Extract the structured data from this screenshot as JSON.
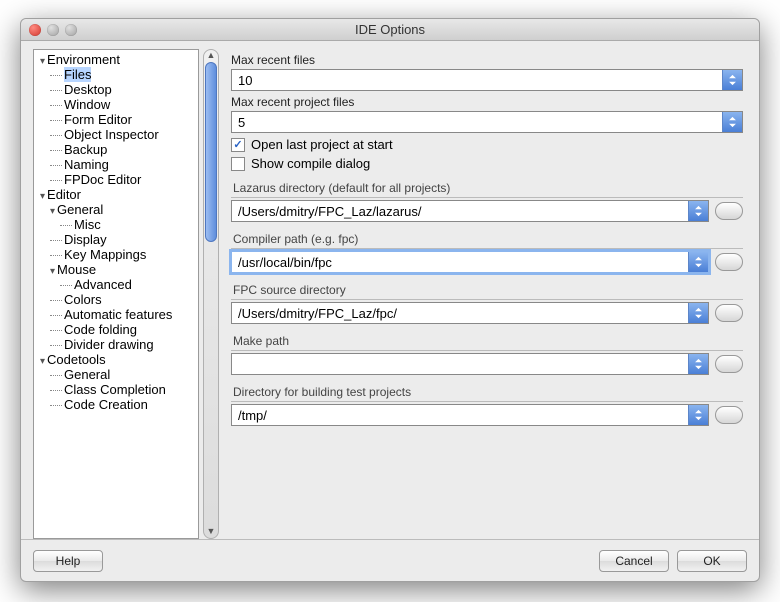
{
  "window": {
    "title": "IDE Options"
  },
  "tree": {
    "nodes": [
      {
        "label": "Environment",
        "level": 0,
        "disc": true
      },
      {
        "label": "Files",
        "level": 1,
        "selected": true
      },
      {
        "label": "Desktop",
        "level": 1
      },
      {
        "label": "Window",
        "level": 1
      },
      {
        "label": "Form Editor",
        "level": 1
      },
      {
        "label": "Object Inspector",
        "level": 1
      },
      {
        "label": "Backup",
        "level": 1
      },
      {
        "label": "Naming",
        "level": 1
      },
      {
        "label": "FPDoc Editor",
        "level": 1
      },
      {
        "label": "Editor",
        "level": 0,
        "disc": true
      },
      {
        "label": "General",
        "level": 1,
        "disc": true
      },
      {
        "label": "Misc",
        "level": 2
      },
      {
        "label": "Display",
        "level": 1
      },
      {
        "label": "Key Mappings",
        "level": 1
      },
      {
        "label": "Mouse",
        "level": 1,
        "disc": true
      },
      {
        "label": "Advanced",
        "level": 2
      },
      {
        "label": "Colors",
        "level": 1
      },
      {
        "label": "Automatic features",
        "level": 1
      },
      {
        "label": "Code folding",
        "level": 1
      },
      {
        "label": "Divider drawing",
        "level": 1
      },
      {
        "label": "Codetools",
        "level": 0,
        "disc": true
      },
      {
        "label": "General",
        "level": 1
      },
      {
        "label": "Class Completion",
        "level": 1
      },
      {
        "label": "Code Creation",
        "level": 1
      }
    ]
  },
  "form": {
    "maxRecentFiles": {
      "label": "Max recent files",
      "value": "10"
    },
    "maxRecentProjects": {
      "label": "Max recent project files",
      "value": "5"
    },
    "openLast": {
      "label": "Open last project at start",
      "checked": true
    },
    "showCompile": {
      "label": "Show compile dialog",
      "checked": false
    },
    "lazDir": {
      "label": "Lazarus directory (default for all projects)",
      "value": "/Users/dmitry/FPC_Laz/lazarus/"
    },
    "compilerPath": {
      "label": "Compiler path (e.g. fpc)",
      "value": "/usr/local/bin/fpc"
    },
    "fpcSrc": {
      "label": "FPC source directory",
      "value": "/Users/dmitry/FPC_Laz/fpc/"
    },
    "makePath": {
      "label": "Make path",
      "value": ""
    },
    "testDir": {
      "label": "Directory for building test projects",
      "value": "/tmp/"
    }
  },
  "buttons": {
    "help": "Help",
    "cancel": "Cancel",
    "ok": "OK"
  }
}
